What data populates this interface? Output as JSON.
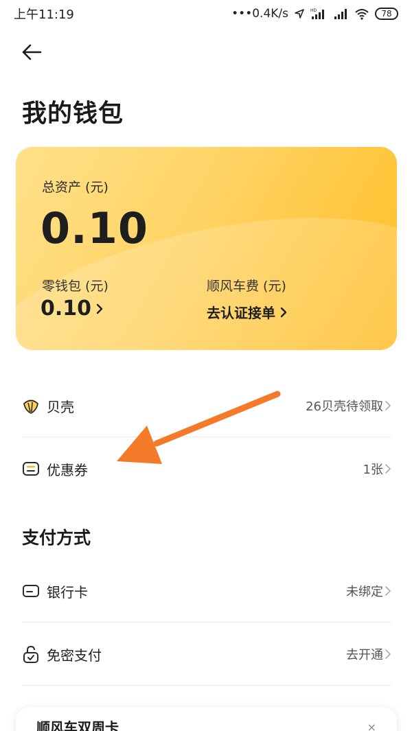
{
  "status_bar": {
    "time": "上午11:19",
    "network_speed": "•••0.4K/s",
    "battery": "78"
  },
  "header": {
    "back_icon": "arrow-left-icon",
    "title": "我的钱包"
  },
  "wallet_card": {
    "total_label": "总资产 (元)",
    "total_value": "0.10",
    "change_label": "零钱包 (元)",
    "change_value": "0.10",
    "ride_label": "顺风车费 (元)",
    "ride_link": "去认证接单",
    "colors": {
      "start": "#ffe18a",
      "end": "#ffbc26"
    }
  },
  "list": {
    "shell": {
      "label": "贝壳",
      "value": "26贝壳待领取",
      "icon": "shell-icon"
    },
    "coupon": {
      "label": "优惠券",
      "value": "1张",
      "icon": "coupon-icon"
    }
  },
  "payment": {
    "title": "支付方式",
    "bank_card": {
      "label": "银行卡",
      "value": "未绑定",
      "icon": "bank-card-icon"
    },
    "password_free": {
      "label": "免密支付",
      "value": "去开通",
      "icon": "lock-icon"
    }
  },
  "promo": {
    "title": "顺风车双周卡",
    "close": "×"
  },
  "annotation": {
    "color": "#f47a2a",
    "icon": "orange-arrow"
  }
}
